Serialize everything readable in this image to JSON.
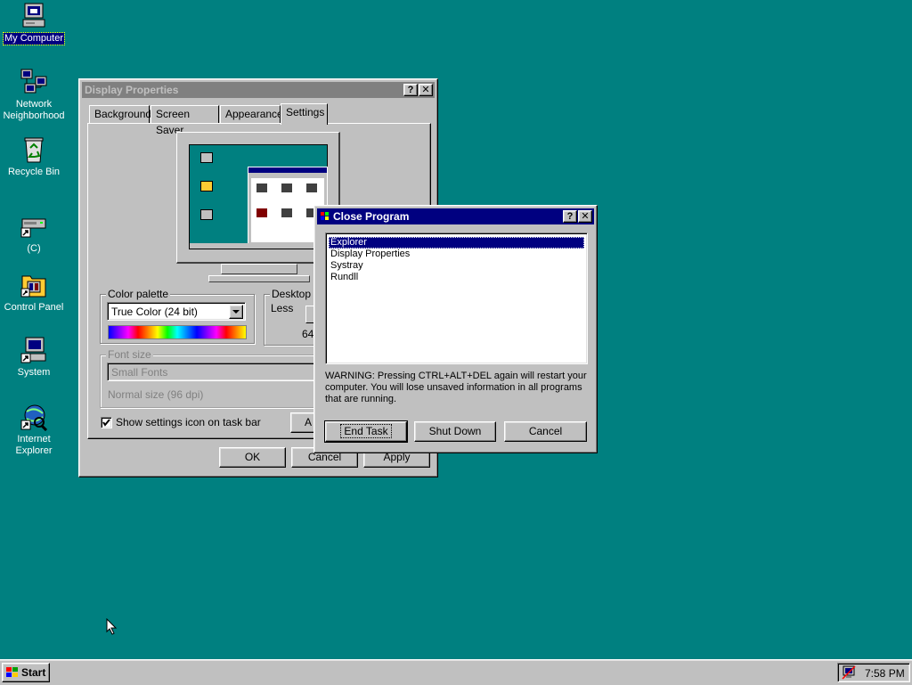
{
  "desktop": {
    "icons": [
      {
        "label": "My Computer",
        "icon": "my-computer-icon"
      },
      {
        "label": "Network Neighborhood",
        "icon": "network-neighborhood-icon"
      },
      {
        "label": "Recycle Bin",
        "icon": "recycle-bin-icon"
      },
      {
        "label": "(C)",
        "icon": "drive-c-shortcut-icon"
      },
      {
        "label": "Control Panel",
        "icon": "control-panel-icon"
      },
      {
        "label": "System",
        "icon": "system-shortcut-icon"
      },
      {
        "label": "Internet Explorer",
        "icon": "internet-explorer-icon"
      }
    ],
    "network_line1": "Network",
    "network_line2": "Neighborhood",
    "ie_line1": "Internet",
    "ie_line2": "Explorer"
  },
  "display_properties": {
    "title": "Display Properties",
    "help_btn": "?",
    "close_btn": "✕",
    "tabs": [
      "Background",
      "Screen Saver",
      "Appearance",
      "Settings"
    ],
    "active_tab": "Settings",
    "color_palette_label": "Color palette",
    "color_palette_value": "True Color (24 bit)",
    "desktop_area_label": "Desktop a",
    "desktop_area_less": "Less",
    "desktop_area_value": "64",
    "font_size_label": "Font size",
    "font_size_value": "Small Fonts",
    "font_size_note": "Normal size (96 dpi)",
    "show_settings_label": "Show settings icon on task bar",
    "show_settings_checked": true,
    "partial_btn": "A",
    "ok": "OK",
    "cancel": "Cancel",
    "apply": "Apply"
  },
  "close_program": {
    "title": "Close Program",
    "help_btn": "?",
    "close_btn": "✕",
    "programs": [
      "Explorer",
      "Display Properties",
      "Systray",
      "Rundll"
    ],
    "selected": "Explorer",
    "warning": "WARNING: Pressing CTRL+ALT+DEL again will restart your computer. You will lose unsaved information in all programs that are running.",
    "end_task": "End Task",
    "shut_down": "Shut Down",
    "cancel": "Cancel"
  },
  "taskbar": {
    "start_label": "Start",
    "clock": "7:58 PM"
  },
  "colors": {
    "desktop": "#008080",
    "face": "#c0c0c0",
    "active_title": "#000080",
    "inactive_title": "#808080"
  }
}
